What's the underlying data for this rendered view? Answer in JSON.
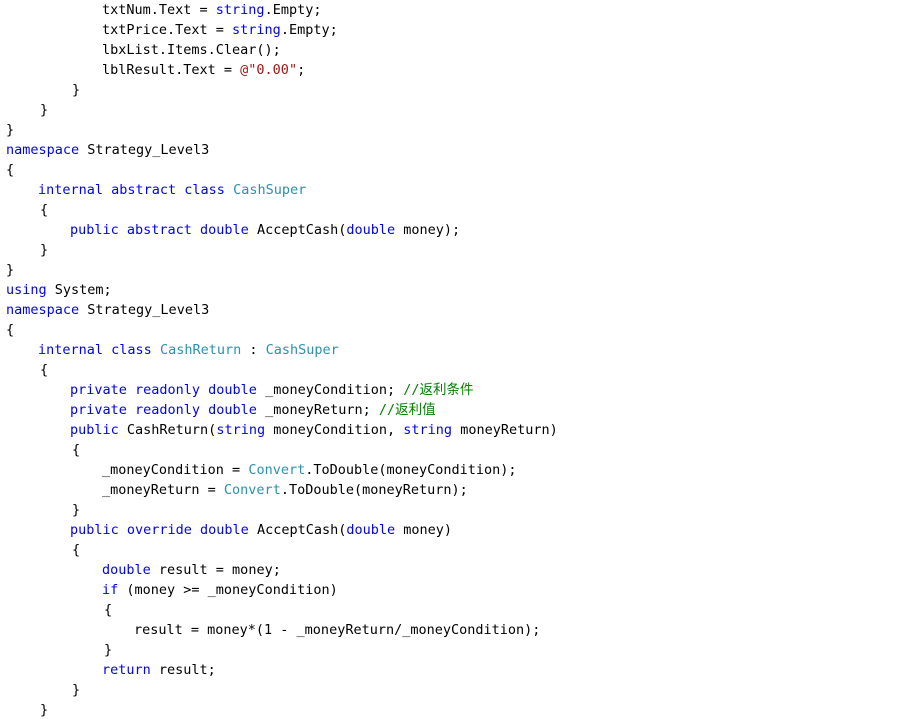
{
  "editor": {
    "colors": {
      "background": "#ffffff",
      "kw": "#0000ff",
      "type": "#2b91af",
      "str": "#a31515",
      "comment": "#008000",
      "plain": "#000000"
    },
    "lines": [
      {
        "indent": 3,
        "tokens": [
          {
            "t": "plain",
            "v": "txtNum.Text = "
          },
          {
            "t": "kw",
            "v": "string"
          },
          {
            "t": "plain",
            "v": ".Empty;"
          }
        ]
      },
      {
        "indent": 3,
        "tokens": [
          {
            "t": "plain",
            "v": "txtPrice.Text = "
          },
          {
            "t": "kw",
            "v": "string"
          },
          {
            "t": "plain",
            "v": ".Empty;"
          }
        ]
      },
      {
        "indent": 3,
        "tokens": [
          {
            "t": "plain",
            "v": "lbxList.Items.Clear();"
          }
        ]
      },
      {
        "indent": 3,
        "tokens": [
          {
            "t": "plain",
            "v": "lblResult.Text = "
          },
          {
            "t": "str",
            "v": "@\"0.00\""
          },
          {
            "t": "plain",
            "v": ";"
          }
        ]
      },
      {
        "indent": 2,
        "tokens": [
          {
            "t": "plain",
            "v": "}"
          }
        ]
      },
      {
        "indent": 1,
        "tokens": [
          {
            "t": "plain",
            "v": "}"
          }
        ]
      },
      {
        "indent": 0,
        "tokens": [
          {
            "t": "plain",
            "v": "}"
          }
        ]
      },
      {
        "indent": 0,
        "tokens": [
          {
            "t": "kw",
            "v": "namespace"
          },
          {
            "t": "plain",
            "v": " Strategy_Level3"
          }
        ]
      },
      {
        "indent": 0,
        "tokens": [
          {
            "t": "plain",
            "v": "{"
          }
        ]
      },
      {
        "indent": 1,
        "tokens": [
          {
            "t": "kw",
            "v": "internal abstract class"
          },
          {
            "t": "plain",
            "v": " "
          },
          {
            "t": "type",
            "v": "CashSuper"
          }
        ]
      },
      {
        "indent": 1,
        "tokens": [
          {
            "t": "plain",
            "v": "{"
          }
        ]
      },
      {
        "indent": 2,
        "tokens": [
          {
            "t": "kw",
            "v": "public abstract double"
          },
          {
            "t": "plain",
            "v": " AcceptCash("
          },
          {
            "t": "kw",
            "v": "double"
          },
          {
            "t": "plain",
            "v": " money);"
          }
        ]
      },
      {
        "indent": 1,
        "tokens": [
          {
            "t": "plain",
            "v": "}"
          }
        ]
      },
      {
        "indent": 0,
        "tokens": [
          {
            "t": "plain",
            "v": "}"
          }
        ]
      },
      {
        "indent": 0,
        "tokens": [
          {
            "t": "kw",
            "v": "using"
          },
          {
            "t": "plain",
            "v": " System;"
          }
        ]
      },
      {
        "indent": 0,
        "tokens": [
          {
            "t": "kw",
            "v": "namespace"
          },
          {
            "t": "plain",
            "v": " Strategy_Level3"
          }
        ]
      },
      {
        "indent": 0,
        "tokens": [
          {
            "t": "plain",
            "v": "{"
          }
        ]
      },
      {
        "indent": 1,
        "tokens": [
          {
            "t": "kw",
            "v": "internal class"
          },
          {
            "t": "plain",
            "v": " "
          },
          {
            "t": "type",
            "v": "CashReturn"
          },
          {
            "t": "plain",
            "v": " : "
          },
          {
            "t": "type",
            "v": "CashSuper"
          }
        ]
      },
      {
        "indent": 1,
        "tokens": [
          {
            "t": "plain",
            "v": "{"
          }
        ]
      },
      {
        "indent": 2,
        "tokens": [
          {
            "t": "kw",
            "v": "private readonly double"
          },
          {
            "t": "plain",
            "v": " _moneyCondition; "
          },
          {
            "t": "comment",
            "v": "//返利条件"
          }
        ]
      },
      {
        "indent": 2,
        "tokens": [
          {
            "t": "kw",
            "v": "private readonly double"
          },
          {
            "t": "plain",
            "v": " _moneyReturn; "
          },
          {
            "t": "comment",
            "v": "//返利值"
          }
        ]
      },
      {
        "indent": 2,
        "tokens": [
          {
            "t": "kw",
            "v": "public"
          },
          {
            "t": "plain",
            "v": " CashReturn("
          },
          {
            "t": "kw",
            "v": "string"
          },
          {
            "t": "plain",
            "v": " moneyCondition, "
          },
          {
            "t": "kw",
            "v": "string"
          },
          {
            "t": "plain",
            "v": " moneyReturn)"
          }
        ]
      },
      {
        "indent": 2,
        "tokens": [
          {
            "t": "plain",
            "v": "{"
          }
        ]
      },
      {
        "indent": 3,
        "tokens": [
          {
            "t": "plain",
            "v": "_moneyCondition = "
          },
          {
            "t": "type",
            "v": "Convert"
          },
          {
            "t": "plain",
            "v": ".ToDouble(moneyCondition);"
          }
        ]
      },
      {
        "indent": 3,
        "tokens": [
          {
            "t": "plain",
            "v": "_moneyReturn = "
          },
          {
            "t": "type",
            "v": "Convert"
          },
          {
            "t": "plain",
            "v": ".ToDouble(moneyReturn);"
          }
        ]
      },
      {
        "indent": 2,
        "tokens": [
          {
            "t": "plain",
            "v": "}"
          }
        ]
      },
      {
        "indent": 2,
        "tokens": [
          {
            "t": "kw",
            "v": "public override double"
          },
          {
            "t": "plain",
            "v": " AcceptCash("
          },
          {
            "t": "kw",
            "v": "double"
          },
          {
            "t": "plain",
            "v": " money)"
          }
        ]
      },
      {
        "indent": 2,
        "tokens": [
          {
            "t": "plain",
            "v": "{"
          }
        ]
      },
      {
        "indent": 3,
        "tokens": [
          {
            "t": "kw",
            "v": "double"
          },
          {
            "t": "plain",
            "v": " result = money;"
          }
        ]
      },
      {
        "indent": 3,
        "tokens": [
          {
            "t": "kw",
            "v": "if"
          },
          {
            "t": "plain",
            "v": " (money >= _moneyCondition)"
          }
        ]
      },
      {
        "indent": 3,
        "tokens": [
          {
            "t": "plain",
            "v": "{"
          }
        ]
      },
      {
        "indent": 4,
        "tokens": [
          {
            "t": "plain",
            "v": "result = money*(1 - _moneyReturn/_moneyCondition);"
          }
        ]
      },
      {
        "indent": 3,
        "tokens": [
          {
            "t": "plain",
            "v": "}"
          }
        ]
      },
      {
        "indent": 3,
        "tokens": [
          {
            "t": "kw",
            "v": "return"
          },
          {
            "t": "plain",
            "v": " result;"
          }
        ]
      },
      {
        "indent": 2,
        "tokens": [
          {
            "t": "plain",
            "v": "}"
          }
        ]
      },
      {
        "indent": 1,
        "tokens": [
          {
            "t": "plain",
            "v": "}"
          }
        ]
      }
    ]
  }
}
